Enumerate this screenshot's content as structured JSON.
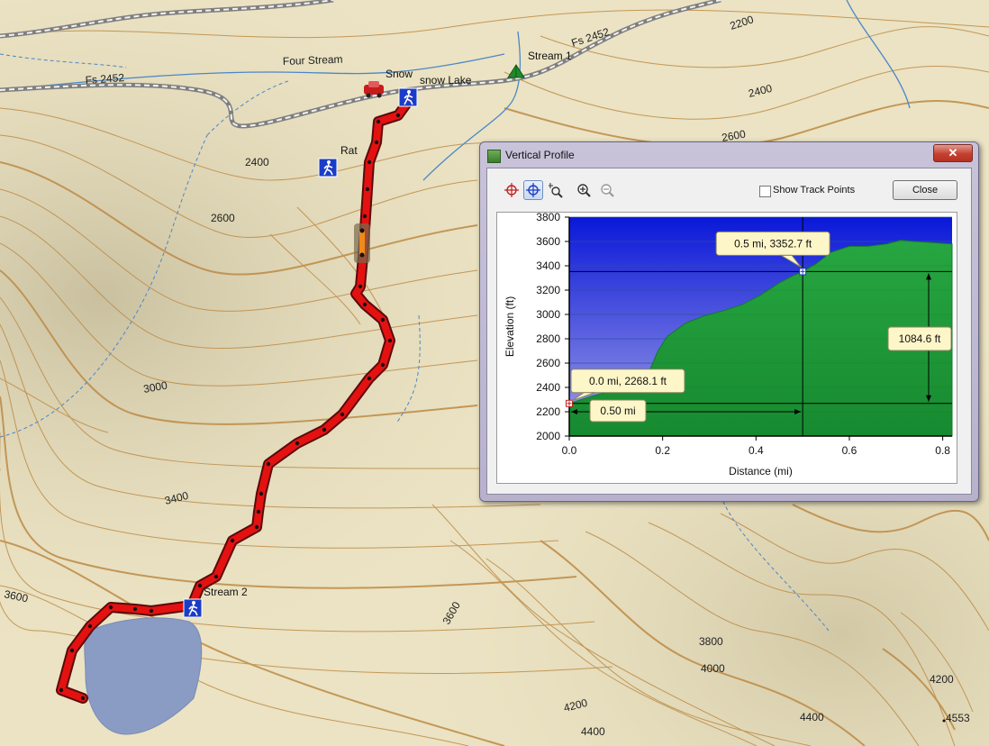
{
  "map": {
    "contour_labels": [
      "2200",
      "2400",
      "2600",
      "2400",
      "2600",
      "3000",
      "3400",
      "3600",
      "3600",
      "3800",
      "4000",
      "4200",
      "4200",
      "4400",
      "4400",
      "4553"
    ],
    "trail_labels": [
      "Fs 2452",
      "Fs 2452",
      "Four Stream"
    ],
    "waypoints": {
      "snow": "Snow",
      "snow_lake": "snow Lake",
      "rat": "Rat",
      "stream1": "Stream 1",
      "stream2": "Stream 2"
    },
    "colors": {
      "track": "#e41111",
      "lake": "#8a9bc4",
      "contour": "#b9843f",
      "stream": "#4c86c8"
    }
  },
  "window": {
    "title": "Vertical Profile",
    "close_x": "✕",
    "show_track_points_label": "Show Track Points",
    "show_track_points_checked": false,
    "close_label": "Close",
    "toolbar_icons": [
      "crosshair-icon",
      "pan-crosshair-icon",
      "zoom-box-icon",
      "zoom-in-icon",
      "zoom-out-icon"
    ]
  },
  "chart_data": {
    "type": "area",
    "xlabel": "Distance   (mi)",
    "ylabel": "Elevation (ft)",
    "xlim": [
      0,
      0.82
    ],
    "ylim": [
      2000,
      3800
    ],
    "x_ticks": [
      "0.0",
      "0.2",
      "0.4",
      "0.6",
      "0.8"
    ],
    "y_ticks": [
      "2000",
      "2200",
      "2400",
      "2600",
      "2800",
      "3000",
      "3200",
      "3400",
      "3600",
      "3800"
    ],
    "profile": {
      "x": [
        0.0,
        0.05,
        0.1,
        0.14,
        0.17,
        0.19,
        0.21,
        0.25,
        0.29,
        0.33,
        0.37,
        0.41,
        0.45,
        0.48,
        0.5,
        0.53,
        0.56,
        0.6,
        0.64,
        0.68,
        0.71,
        0.74,
        0.78,
        0.82
      ],
      "y": [
        2268,
        2330,
        2380,
        2420,
        2520,
        2700,
        2820,
        2930,
        2990,
        3030,
        3080,
        3160,
        3260,
        3320,
        3352,
        3420,
        3510,
        3560,
        3560,
        3580,
        3610,
        3600,
        3590,
        3580
      ]
    },
    "markers": {
      "start": {
        "label": "0.0 mi, 2268.1 ft",
        "x": 0.0,
        "y": 2268.1
      },
      "end": {
        "label": "0.5 mi, 3352.7 ft",
        "x": 0.5,
        "y": 3352.7
      },
      "distance_label": "0.50 mi",
      "elevation_gain_label": "1084.6 ft"
    },
    "colors": {
      "sky_top": "#0a18d8",
      "sky_bottom": "#a0a0e6",
      "ground": "#1f9c3a"
    }
  }
}
